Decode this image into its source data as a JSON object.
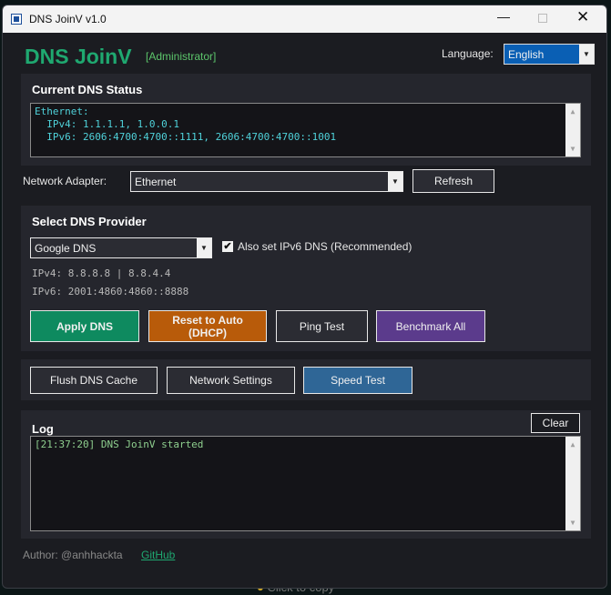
{
  "background": {
    "hint": "Click to copy"
  },
  "window": {
    "title": "DNS JoinV v1.0"
  },
  "header": {
    "app_name": "DNS JoinV",
    "role": "[Administrator]",
    "language_label": "Language:",
    "language_value": "English"
  },
  "status": {
    "heading": "Current DNS Status",
    "lines": [
      "Ethernet:",
      "  IPv4: 1.1.1.1, 1.0.0.1",
      "  IPv6: 2606:4700:4700::1111, 2606:4700:4700::1001"
    ]
  },
  "adapter": {
    "label": "Network Adapter:",
    "value": "Ethernet",
    "refresh": "Refresh"
  },
  "provider": {
    "heading": "Select DNS Provider",
    "value": "Google DNS",
    "ipv6_checkbox": "Also set IPv6 DNS (Recommended)",
    "ipv6_checked": true,
    "ipv4": "IPv4: 8.8.8.8 | 8.8.4.4",
    "ipv6": "IPv6: 2001:4860:4860::8888",
    "buttons": {
      "apply": "Apply DNS",
      "reset_line1": "Reset to Auto",
      "reset_line2": "(DHCP)",
      "ping": "Ping Test",
      "benchmark": "Benchmark All"
    }
  },
  "tools": {
    "flush": "Flush DNS Cache",
    "network": "Network Settings",
    "speed": "Speed Test"
  },
  "log": {
    "heading": "Log",
    "clear": "Clear",
    "entries": [
      "[21:37:20] DNS JoinV started"
    ]
  },
  "footer": {
    "author": "Author: @anhhackta",
    "github": "GitHub"
  },
  "colors": {
    "accent": "#1fa870",
    "apply": "#0e8a5f",
    "reset": "#b85b0a",
    "benchmark": "#5b3b8c",
    "speed": "#2f6696",
    "language": "#0a5fb4",
    "status_text": "#4fd1d9",
    "log_text": "#8fd08f"
  }
}
